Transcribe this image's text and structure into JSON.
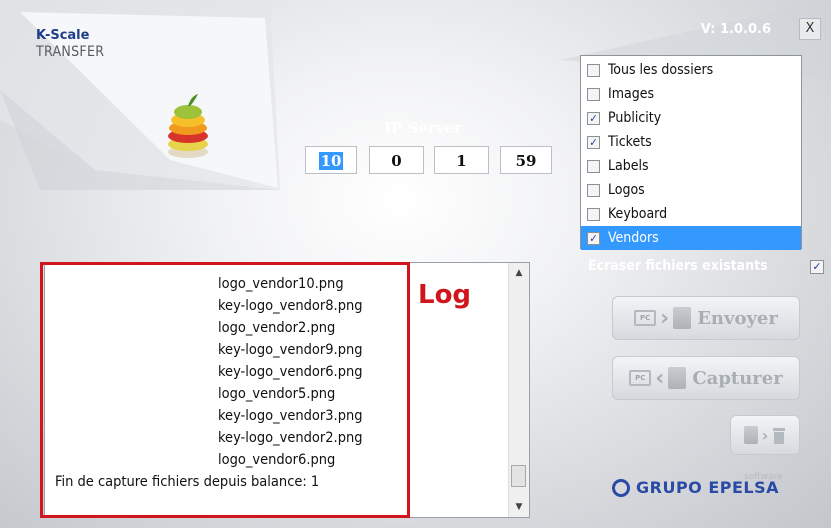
{
  "app": {
    "name": "K-Scale",
    "subtitle": "TRANSFER",
    "version": "V: 1.0.0.6",
    "close_label": "X"
  },
  "ip": {
    "label": "IP Server",
    "octets": [
      "10",
      "0",
      "1",
      "59"
    ]
  },
  "folders": {
    "items": [
      {
        "label": "Tous les dossiers",
        "checked": false,
        "selected": false
      },
      {
        "label": "Images",
        "checked": false,
        "selected": false
      },
      {
        "label": "Publicity",
        "checked": true,
        "selected": false
      },
      {
        "label": "Tickets",
        "checked": true,
        "selected": false
      },
      {
        "label": "Labels",
        "checked": false,
        "selected": false
      },
      {
        "label": "Logos",
        "checked": false,
        "selected": false
      },
      {
        "label": "Keyboard",
        "checked": false,
        "selected": false
      },
      {
        "label": "Vendors",
        "checked": true,
        "selected": true
      }
    ]
  },
  "overwrite": {
    "label": "Ecraser fichiers existants",
    "checked": true
  },
  "actions": {
    "send_label": "Envoyer",
    "capture_label": "Capturer",
    "pc_badge": "PC"
  },
  "log": {
    "annotation": "Log",
    "files": [
      "logo_vendor10.png",
      "key-logo_vendor8.png",
      "logo_vendor2.png",
      "key-logo_vendor9.png",
      "key-logo_vendor6.png",
      "logo_vendor5.png",
      "key-logo_vendor3.png",
      "key-logo_vendor2.png",
      "logo_vendor6.png"
    ],
    "final_line": "Fin de capture fichiers depuis balance: 1"
  },
  "brand": {
    "name": "GRUPO EPELSA",
    "tag": "software"
  },
  "colors": {
    "selection": "#3399ff",
    "annotation": "#d0161c",
    "brand": "#2a4aa5"
  }
}
